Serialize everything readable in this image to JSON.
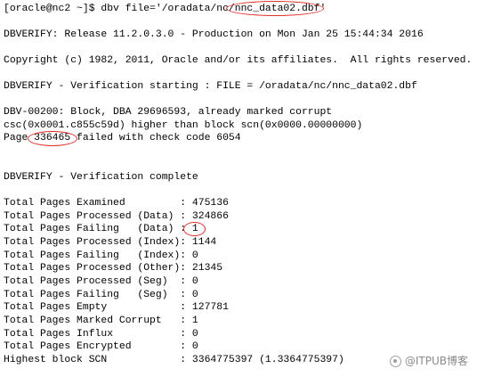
{
  "terminal": {
    "lines": [
      "[oracle@nc2 ~]$ dbv file='/oradata/nc/nnc_data02.dbf'",
      "DBVERIFY: Release 11.2.0.3.0 - Production on Mon Jan 25 15:44:34 2016",
      "Copyright (c) 1982, 2011, Oracle and/or its affiliates.  All rights reserved.",
      "DBVERIFY - Verification starting : FILE = /oradata/nc/nnc_data02.dbf",
      "DBV-00200: Block, DBA 29696593, already marked corrupt",
      "csc(0x0001.c855c59d) higher than block scn(0x0000.00000000)",
      "Page 336465 failed with check code 6054",
      "DBVERIFY - Verification complete",
      "Total Pages Examined         : 475136",
      "Total Pages Processed (Data) : 324866",
      "Total Pages Failing   (Data) : 1",
      "Total Pages Processed (Index): 1144",
      "Total Pages Failing   (Index): 0",
      "Total Pages Processed (Other): 21345",
      "Total Pages Processed (Seg)  : 0",
      "Total Pages Failing   (Seg)  : 0",
      "Total Pages Empty            : 127781",
      "Total Pages Marked Corrupt   : 1",
      "Total Pages Influx           : 0",
      "Total Pages Encrypted        : 0",
      "Highest block SCN            : 3364775397 (1.3364775397)"
    ]
  },
  "annotation_color": "#e0302a",
  "watermark": {
    "icon": "itpub-logo-icon",
    "text": "@ITPUB博客"
  }
}
